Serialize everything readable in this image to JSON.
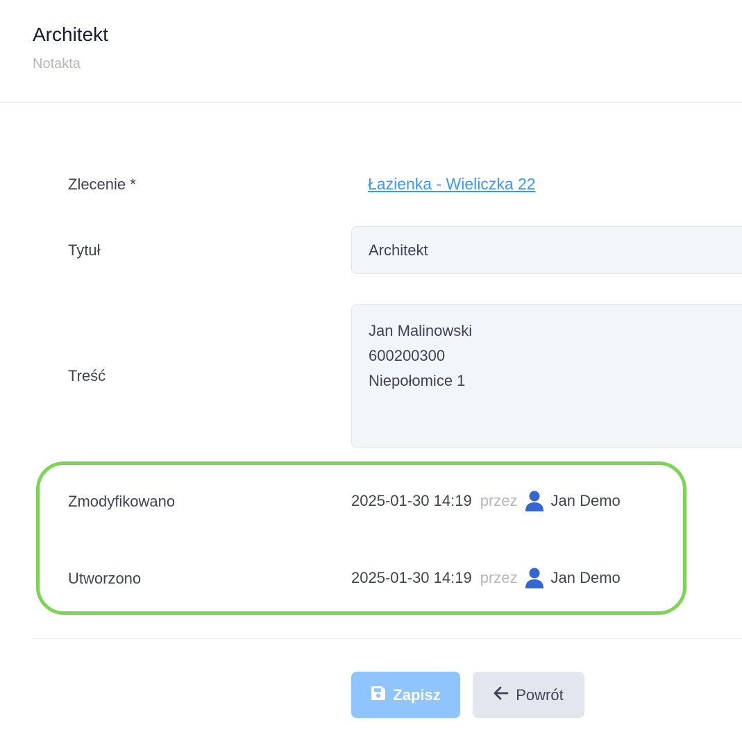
{
  "header": {
    "title": "Architekt",
    "subtitle": "Notakta"
  },
  "form": {
    "order_label": "Zlecenie *",
    "order_link": "Łazienka - Wieliczka 22",
    "title_label": "Tytuł",
    "title_value": "Architekt",
    "content_label": "Treść",
    "content_value": "Jan Malinowski\n600200300\nNiepołomice 1"
  },
  "meta": {
    "modified_label": "Zmodyfikowano",
    "modified_date": "2025-01-30 14:19",
    "modified_by_word": "przez",
    "modified_user": "Jan Demo",
    "created_label": "Utworzono",
    "created_date": "2025-01-30 14:19",
    "created_by_word": "przez",
    "created_user": "Jan Demo",
    "highlight_color": "#79d552"
  },
  "actions": {
    "save_label": "Zapisz",
    "save_icon": "save-icon",
    "back_label": "Powrót",
    "back_icon": "arrow-left-icon"
  },
  "colors": {
    "link": "#3699ff",
    "user_icon": "#3467d0",
    "save_button": "#8fc4fd",
    "back_button": "#e4e6ef"
  }
}
